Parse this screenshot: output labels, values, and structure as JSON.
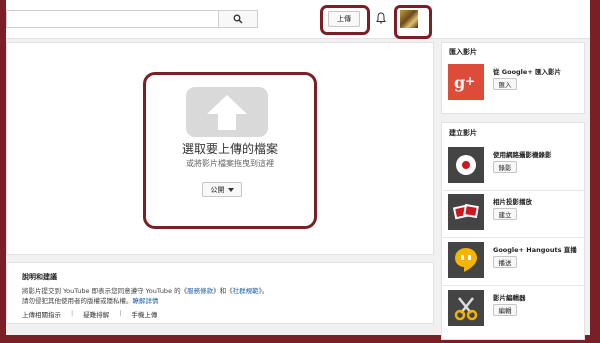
{
  "header": {
    "upload_label": "上傳"
  },
  "upload_area": {
    "title": "選取要上傳的檔案",
    "subtitle": "或將影片檔案拖曳到這裡",
    "privacy_value": "公開"
  },
  "help": {
    "title": "說明和建議",
    "text_line1_a": "將影片提交到 YouTube 即表示您同意遵守 YouTube 的《",
    "tos_link": "服務條款",
    "text_line1_b": "》和《",
    "guidelines_link": "社群規範",
    "text_line1_c": "》。",
    "text_line2": "請勿侵犯其他使用者的版權或隱私權。",
    "learn_more_link": "瞭解詳情",
    "links": [
      "上傳相關指示",
      "疑難排解",
      "手機上傳"
    ]
  },
  "sidebar": {
    "import_heading": "匯入影片",
    "import_item": {
      "label": "從 Google+ 匯入影片",
      "button": "匯入"
    },
    "create_heading": "建立影片",
    "create_items": [
      {
        "label": "使用網路攝影機錄影",
        "button": "錄影",
        "icon": "record-icon"
      },
      {
        "label": "相片投影播放",
        "button": "建立",
        "icon": "photo-slideshow-icon"
      },
      {
        "label": "Google+ Hangouts 直播",
        "button": "播送",
        "icon": "hangouts-icon"
      },
      {
        "label": "影片編輯器",
        "button": "編輯",
        "icon": "scissors-icon"
      }
    ]
  },
  "colors": {
    "frame": "#7a1f25",
    "google_plus": "#dd4b39",
    "hangouts": "#f4b400",
    "link": "#1a5eb0"
  }
}
